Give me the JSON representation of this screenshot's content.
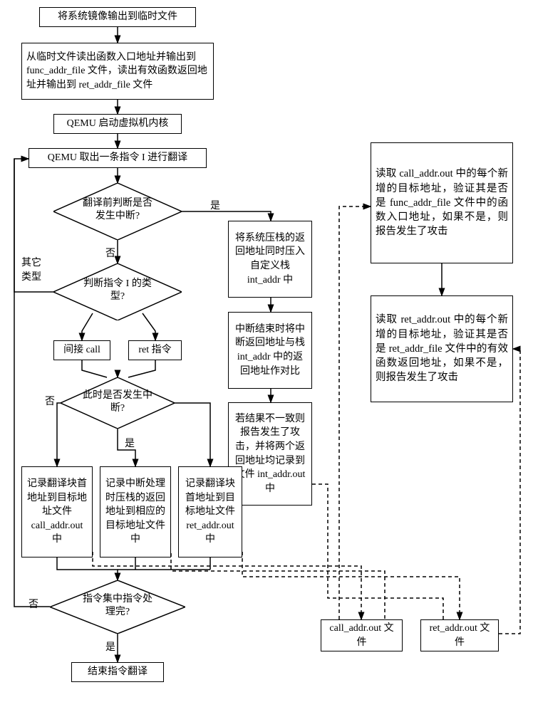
{
  "flowchart": {
    "nodes": {
      "n1": "将系统镜像输出到临时文件",
      "n2": "从临时文件读出函数入口地址并输出到 func_addr_file 文件，读出有效函数返回地址并输出到 ret_addr_file 文件",
      "n3": "QEMU 启动虚拟机内核",
      "n4": "QEMU 取出一条指令 I 进行翻译",
      "d1": "翻译前判断是否发生中断?",
      "d2": "判断指令 I 的类型?",
      "d3": "此时是否发生中断?",
      "d4": "指令集中指令处理完?",
      "t_call": "间接 call",
      "t_ret": "ret 指令",
      "n5": "将系统压栈的返回地址同时压入自定义栈 int_addr 中",
      "n6": "中断结束时将中断返回地址与栈 int_addr 中的返回地址作对比",
      "n7": "若结果不一致则报告发生了攻击，并将两个返回地址均记录到文件 int_addr.out 中",
      "r1": "记录翻译块首地址到目标地址文件 call_addr.out 中",
      "r2": "记录中断处理时压栈的返回地址到相应的目标地址文件中",
      "r3": "记录翻译块首地址到目标地址文件 ret_addr.out 中",
      "f1": "call_addr.out 文件",
      "f2": "ret_addr.out 文件",
      "v1": "读取 call_addr.out 中的每个新增的目标地址，验证其是否是 func_addr_file 文件中的函数入口地址，如果不是，则报告发生了攻击",
      "v2": "读取 ret_addr.out 中的每个新增的目标地址，验证其是否是 ret_addr_file 文件中的有效函数返回地址，如果不是，则报告发生了攻击",
      "end": "结束指令翻译"
    },
    "labels": {
      "yes": "是",
      "no": "否",
      "other_type": "其它类型"
    }
  }
}
